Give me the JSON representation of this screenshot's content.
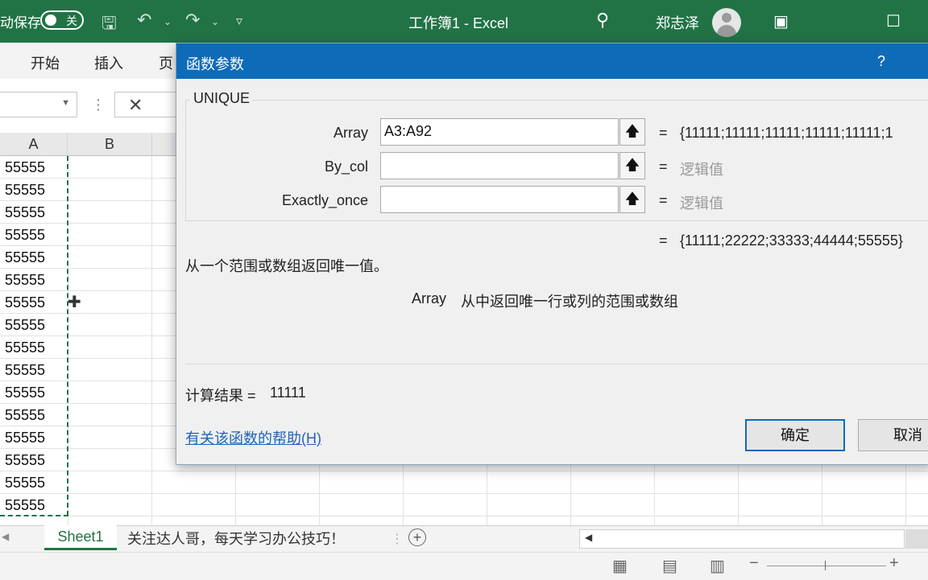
{
  "titlebar": {
    "autosave_label": "动保存",
    "autosave_state": "关",
    "title": "工作簿1 - Excel",
    "user": "郑志泽",
    "icons": [
      "save-icon",
      "undo-icon",
      "redo-icon",
      "customize-icon",
      "search-icon",
      "ribbon-display-icon",
      "maximize-icon"
    ]
  },
  "ribbon": {
    "tabs": [
      "开始",
      "插入",
      "页"
    ]
  },
  "grid": {
    "columns": [
      "A",
      "B"
    ],
    "columnA_values": [
      "55555",
      "55555",
      "55555",
      "55555",
      "55555",
      "55555",
      "55555",
      "55555",
      "55555",
      "55555",
      "55555",
      "55555",
      "55555",
      "55555",
      "55555",
      "55555"
    ]
  },
  "sheets": {
    "active": "Sheet1",
    "second": "关注达人哥，每天学习办公技巧！"
  },
  "dialog": {
    "title": "函数参数",
    "help_char": "?",
    "function_name": "UNIQUE",
    "args": [
      {
        "label": "Array",
        "value": "A3:A92",
        "result": "{11111;11111;11111;11111;11111;1"
      },
      {
        "label": "By_col",
        "value": "",
        "result": "逻辑值"
      },
      {
        "label": "Exactly_once",
        "value": "",
        "result": "逻辑值"
      }
    ],
    "eq": "=",
    "overall_result": "{11111;22222;33333;44444;55555}",
    "description": "从一个范围或数组返回唯一值。",
    "arg_desc_name": "Array",
    "arg_desc_text": "从中返回唯一行或列的范围或数组",
    "calc_label": "计算结果 =",
    "calc_value": "11111",
    "help_link": "有关该函数的帮助(H)",
    "ok": "确定",
    "cancel": "取消"
  }
}
